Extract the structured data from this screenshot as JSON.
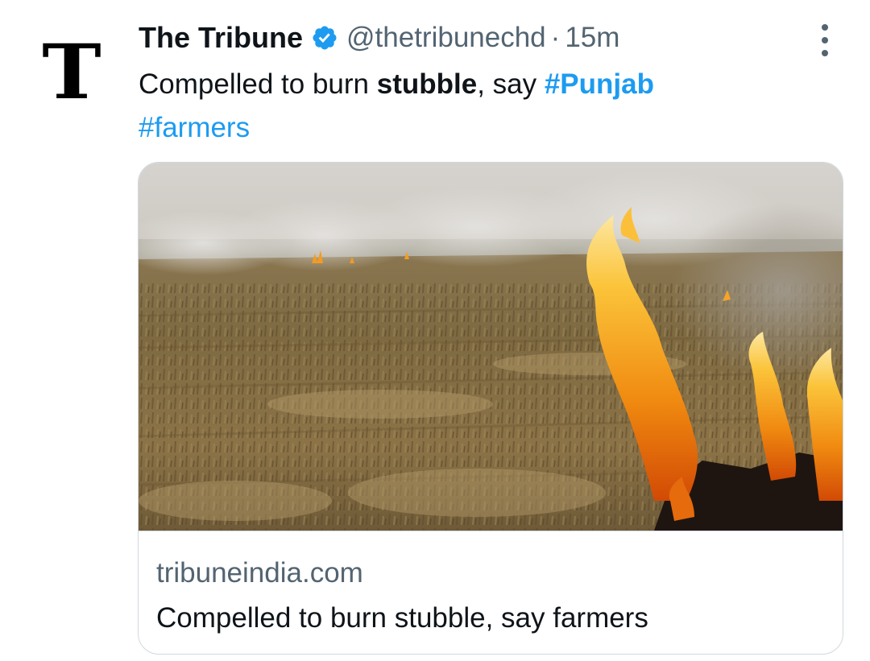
{
  "avatar": {
    "letter": "T",
    "icon": "tribune-logo-icon"
  },
  "tweet": {
    "author_name": "The Tribune",
    "verified_icon": "verified-badge-icon",
    "handle": "@thetribunechd",
    "separator": "·",
    "time": "15m",
    "more_icon": "more-options-icon",
    "text": {
      "part1": "Compelled to burn ",
      "part2_bold": "stubble",
      "part3": ", say ",
      "hashtag1": "#Punjab",
      "hashtag2": "#farmers"
    }
  },
  "card": {
    "image_alt": "stubble-burning-field-image",
    "domain": "tribuneindia.com",
    "title": "Compelled to burn stubble, say farmers"
  },
  "colors": {
    "text_primary": "#0f1419",
    "text_secondary": "#536471",
    "link": "#1d9bf0",
    "border": "#cfd9de"
  }
}
